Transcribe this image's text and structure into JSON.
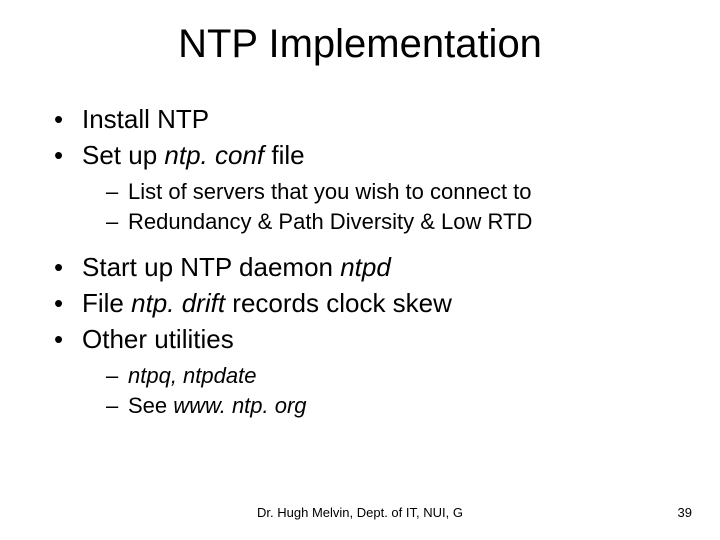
{
  "title": "NTP Implementation",
  "bullets": {
    "b0": "Install NTP",
    "b1_pre": "Set up ",
    "b1_em": "ntp. conf",
    "b1_post": " file",
    "b1_sub0": "List of servers that you wish to connect to",
    "b1_sub1": "Redundancy & Path Diversity & Low RTD",
    "b2_pre": "Start up NTP daemon ",
    "b2_em": "ntpd",
    "b3_pre": "File ",
    "b3_em": "ntp. drift",
    "b3_post": " records clock skew",
    "b4": "Other utilities",
    "b4_sub0": "ntpq, ntpdate",
    "b4_sub1_pre": "See ",
    "b4_sub1_em": "www. ntp. org"
  },
  "footer": "Dr. Hugh Melvin, Dept. of IT, NUI, G",
  "page": "39"
}
